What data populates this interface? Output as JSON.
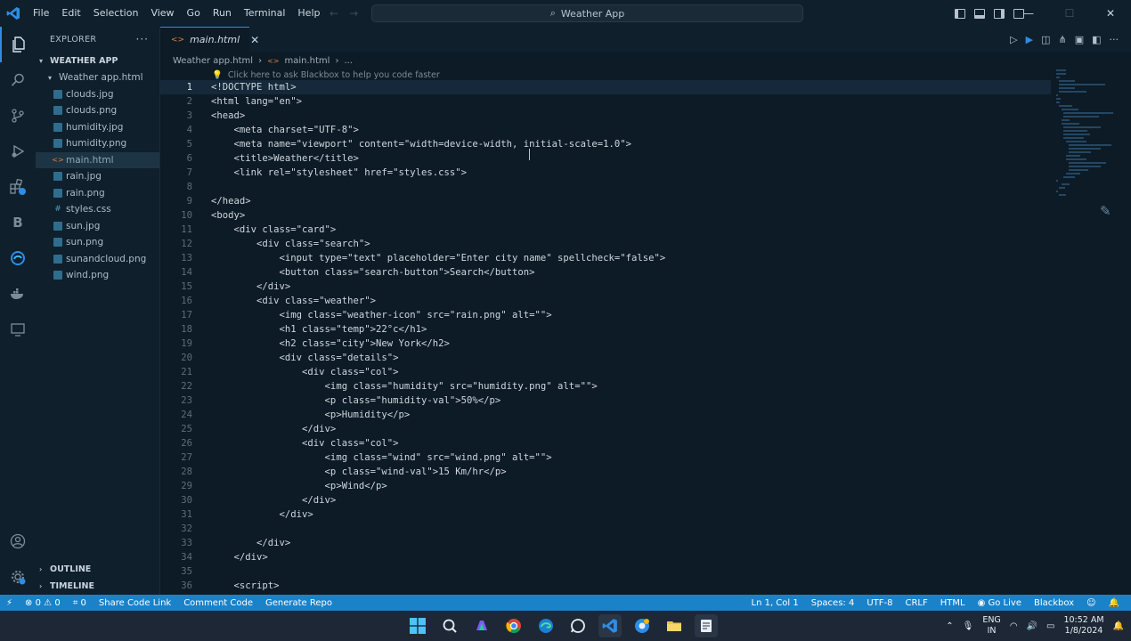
{
  "menu": [
    "File",
    "Edit",
    "Selection",
    "View",
    "Go",
    "Run",
    "Terminal",
    "Help"
  ],
  "command_center": {
    "label": "Weather App"
  },
  "explorer": {
    "title": "EXPLORER",
    "folder": "WEATHER APP",
    "subfolder": "Weather app.html",
    "files": [
      {
        "name": "clouds.jpg",
        "type": "img"
      },
      {
        "name": "clouds.png",
        "type": "img"
      },
      {
        "name": "humidity.jpg",
        "type": "img"
      },
      {
        "name": "humidity.png",
        "type": "img"
      },
      {
        "name": "main.html",
        "type": "html"
      },
      {
        "name": "rain.jpg",
        "type": "img"
      },
      {
        "name": "rain.png",
        "type": "img"
      },
      {
        "name": "styles.css",
        "type": "css"
      },
      {
        "name": "sun.jpg",
        "type": "img"
      },
      {
        "name": "sun.png",
        "type": "img"
      },
      {
        "name": "sunandcloud.png",
        "type": "img"
      },
      {
        "name": "wind.png",
        "type": "img"
      }
    ],
    "outline": "OUTLINE",
    "timeline": "TIMELINE"
  },
  "tab": {
    "label": "main.html"
  },
  "breadcrumb": {
    "folder": "Weather app.html",
    "file": "main.html",
    "more": "..."
  },
  "hint": "Click here to ask Blackbox to help you code faster",
  "code_lines": [
    "<!DOCTYPE html>",
    "<html lang=\"en\">",
    "<head>",
    "    <meta charset=\"UTF-8\">",
    "    <meta name=\"viewport\" content=\"width=device-width, initial-scale=1.0\">",
    "    <title>Weather</title>",
    "    <link rel=\"stylesheet\" href=\"styles.css\">",
    "",
    "</head>",
    "<body>",
    "    <div class=\"card\">",
    "        <div class=\"search\">",
    "            <input type=\"text\" placeholder=\"Enter city name\" spellcheck=\"false\">",
    "            <button class=\"search-button\">Search</button>",
    "        </div>",
    "        <div class=\"weather\">",
    "            <img class=\"weather-icon\" src=\"rain.png\" alt=\"\">",
    "            <h1 class=\"temp\">22°c</h1>",
    "            <h2 class=\"city\">New York</h2>",
    "            <div class=\"details\">",
    "                <div class=\"col\">",
    "                    <img class=\"humidity\" src=\"humidity.png\" alt=\"\">",
    "                    <p class=\"humidity-val\">50%</p>",
    "                    <p>Humidity</p>",
    "                </div>",
    "                <div class=\"col\">",
    "                    <img class=\"wind\" src=\"wind.png\" alt=\"\">",
    "                    <p class=\"wind-val\">15 Km/hr</p>",
    "                    <p>Wind</p>",
    "                </div>",
    "            </div>",
    "",
    "        </div>",
    "    </div>",
    "",
    "    <script>"
  ],
  "status": {
    "errors": "0",
    "warnings": "0",
    "ports": "0",
    "share": "Share Code Link",
    "comment": "Comment Code",
    "generate": "Generate Repo",
    "position": "Ln 1, Col 1",
    "spaces": "Spaces: 4",
    "encoding": "UTF-8",
    "eol": "CRLF",
    "language": "HTML",
    "golive": "Go Live",
    "blackbox": "Blackbox"
  },
  "taskbar": {
    "lang1": "ENG",
    "lang2": "IN",
    "time": "10:52 AM",
    "date": "1/8/2024"
  }
}
